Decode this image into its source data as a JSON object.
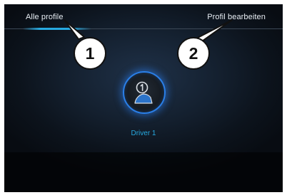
{
  "tabs": {
    "all_profiles": "Alle profile",
    "edit_profile": "Profil bearbeiten"
  },
  "callouts": [
    "1",
    "2"
  ],
  "profiles": [
    {
      "name": "Driver 1",
      "number_icon": "circled-digit-1-icon"
    }
  ],
  "colors": {
    "accent": "#27aae1",
    "avatar_ring": "#2a7fe8",
    "background": "#101a26"
  }
}
